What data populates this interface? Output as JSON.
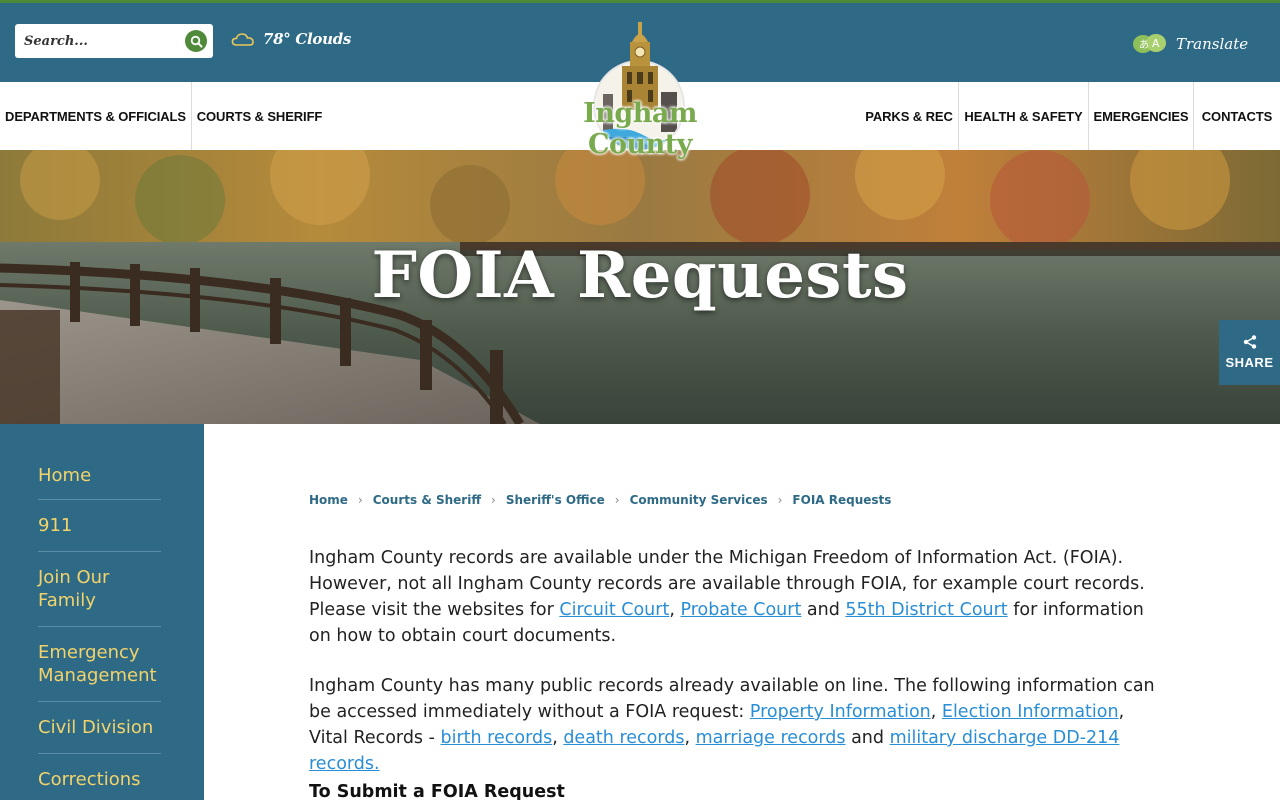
{
  "header": {
    "search_placeholder": "Search...",
    "weather": "78° Clouds",
    "translate_label": "Translate"
  },
  "nav": {
    "left": [
      "DEPARTMENTS & OFFICIALS",
      "COURTS & SHERIFF"
    ],
    "right": [
      "PARKS & REC",
      "HEALTH & SAFETY",
      "EMERGENCIES",
      "CONTACTS"
    ]
  },
  "logo": {
    "text": "Ingham County"
  },
  "hero": {
    "title": "FOIA Requests"
  },
  "share": {
    "label": "SHARE"
  },
  "sidebar": {
    "items": [
      "Home",
      "911",
      "Join Our Family",
      "Emergency Management",
      "Civil Division",
      "Corrections"
    ]
  },
  "breadcrumb": [
    "Home",
    "Courts & Sheriff",
    "Sheriff's Office",
    "Community Services",
    "FOIA Requests"
  ],
  "content": {
    "p1": {
      "t1": "Ingham County records are available under the Michigan Freedom of Information Act. (FOIA). However, not all Ingham County records are available through FOIA, for example court records. Please visit the websites for ",
      "link1": "Circuit Court",
      "t2": ", ",
      "link2": "Probate Court",
      "t3": " and ",
      "link3": "55th District Court",
      "t4": " for information on how to obtain court documents."
    },
    "p2": {
      "t1": "Ingham County has many public records already available on line.  The following information can be accessed immediately without a FOIA request:  ",
      "link1": "Property Information",
      "t2": ", ",
      "link2": "Election Information",
      "t3": ", Vital Records - ",
      "link3": "birth records",
      "t4": ", ",
      "link4": "death records",
      "t5": ", ",
      "link5": "marriage records",
      "t6": " and ",
      "link6": "military discharge DD-214 records."
    },
    "subheading": "To Submit a FOIA Request"
  },
  "colors": {
    "primary": "#2e6a86",
    "accent_green": "#4f8a3a",
    "sidebar_text": "#f2d36b",
    "link": "#2a8ed6"
  }
}
